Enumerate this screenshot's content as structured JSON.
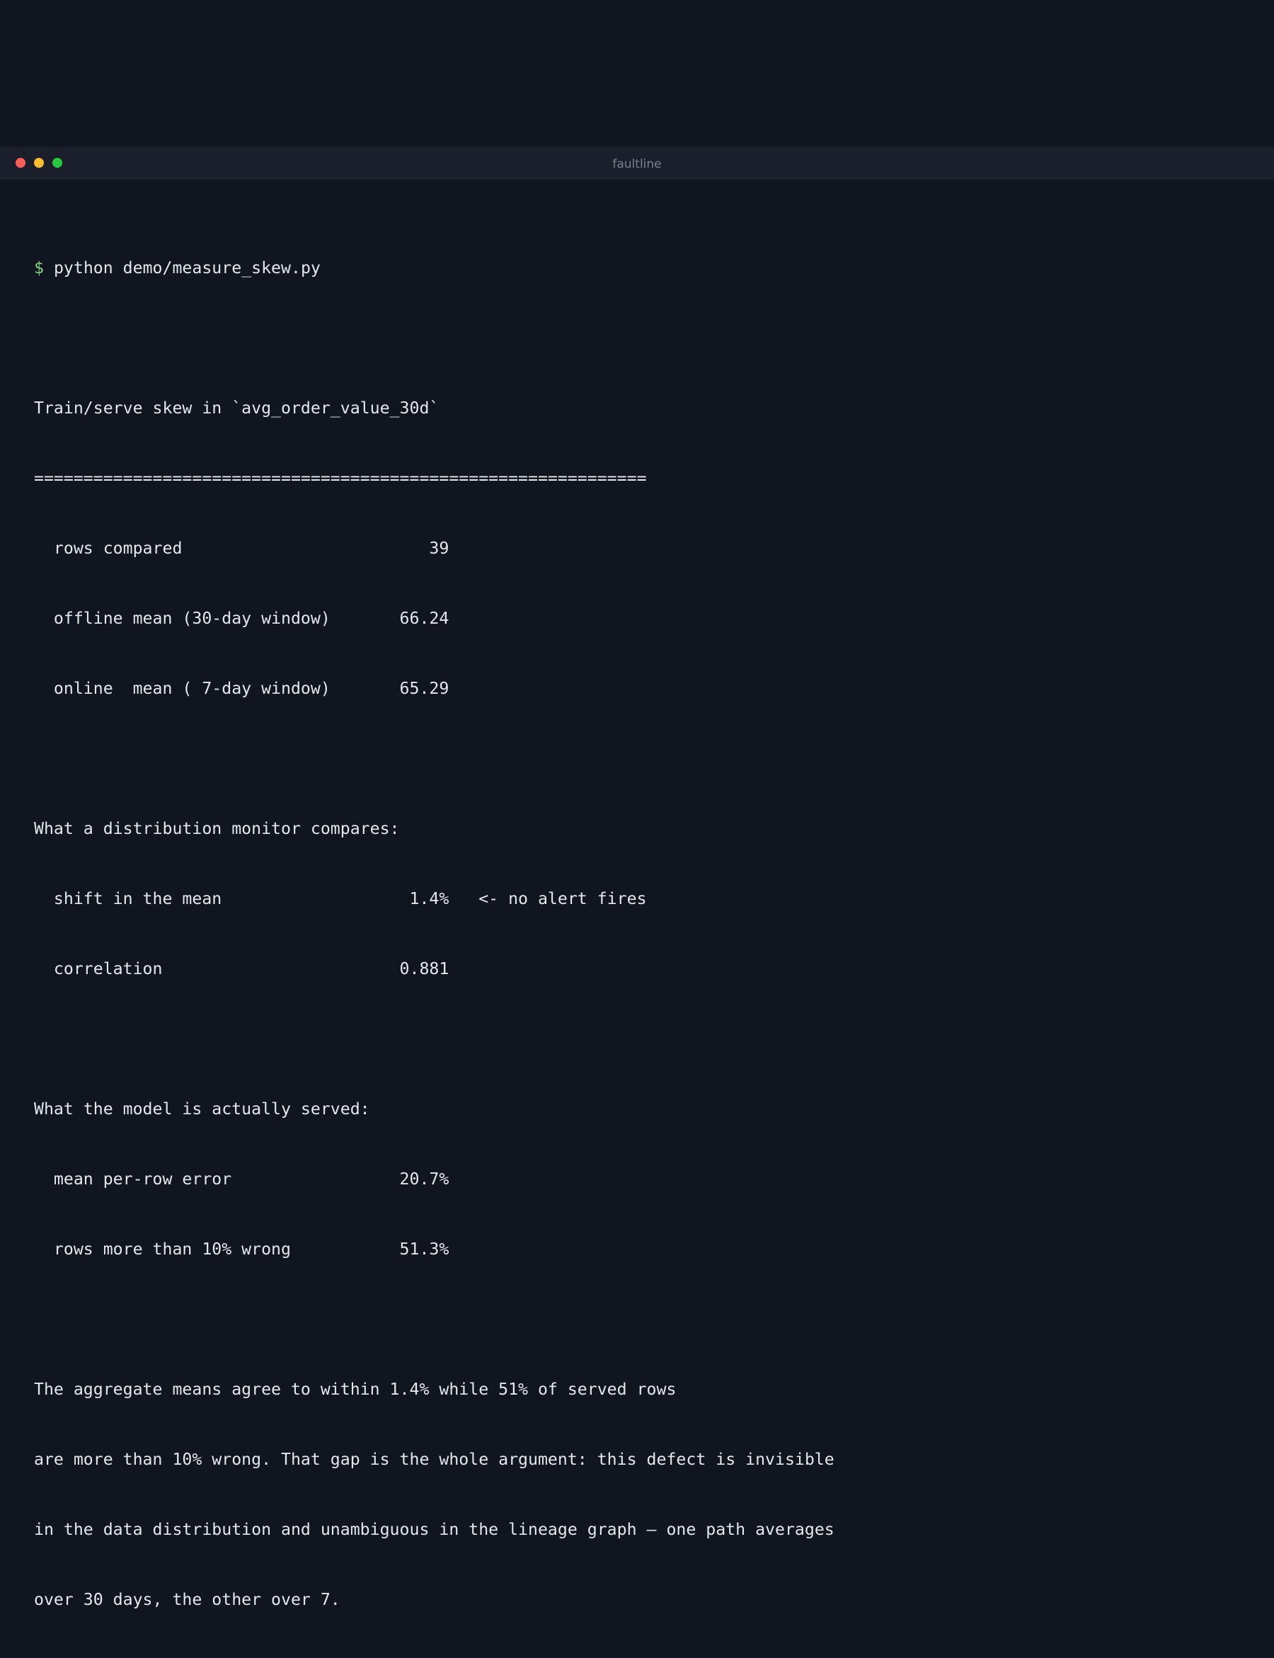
{
  "window": {
    "title": "faultline"
  },
  "terminal": {
    "prompt_symbol": "$",
    "command": "python demo/measure_skew.py",
    "output_lines": [
      "",
      "Train/serve skew in `avg_order_value_30d`",
      "==============================================================",
      "  rows compared                         39",
      "  offline mean (30-day window)       66.24",
      "  online  mean ( 7-day window)       65.29",
      "",
      "What a distribution monitor compares:",
      "  shift in the mean                   1.4%   <- no alert fires",
      "  correlation                        0.881",
      "",
      "What the model is actually served:",
      "  mean per-row error                 20.7%",
      "  rows more than 10% wrong           51.3%",
      "",
      "The aggregate means agree to within 1.4% while 51% of served rows",
      "are more than 10% wrong. That gap is the whole argument: this defect is invisible",
      "in the data distribution and unambiguous in the lineage graph — one path averages",
      "over 30 days, the other over 7."
    ]
  },
  "colors": {
    "background": "#111520",
    "title_bar": "#1a1f2b",
    "text": "#e4e7ec",
    "prompt": "#7ed07e",
    "title_text": "#7a808c",
    "close": "#ff5f57",
    "minimize": "#febc2e",
    "maximize": "#28c840"
  }
}
